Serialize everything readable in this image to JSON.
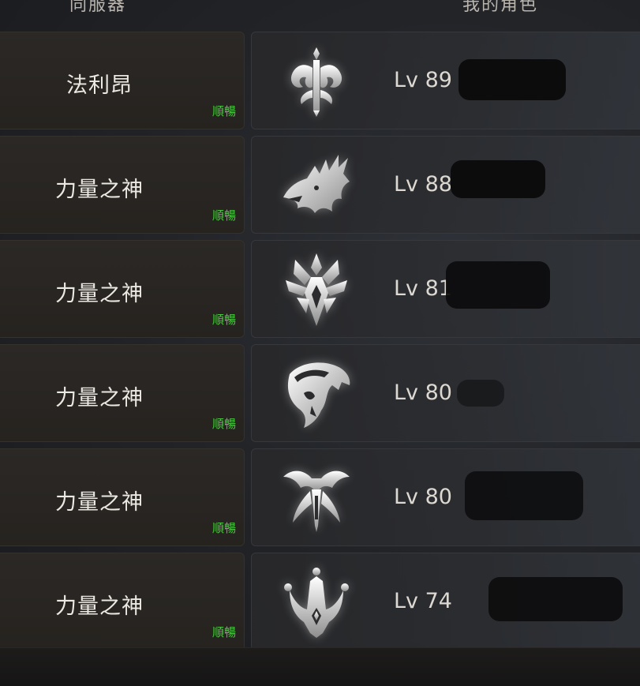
{
  "header": {
    "server_col": "同服器",
    "character_col": "我的角色"
  },
  "rows": [
    {
      "server": "法利昂",
      "status": "順暢",
      "level": "Lv 89",
      "emblem": "sword-wings-emblem-icon"
    },
    {
      "server": "力量之神",
      "status": "順暢",
      "level": "Lv 88",
      "emblem": "dragon-head-emblem-icon"
    },
    {
      "server": "力量之神",
      "status": "順暢",
      "level": "Lv 81",
      "emblem": "thorn-crown-emblem-icon"
    },
    {
      "server": "力量之神",
      "status": "順暢",
      "level": "Lv 80",
      "emblem": "helmet-skull-emblem-icon"
    },
    {
      "server": "力量之神",
      "status": "順暢",
      "level": "Lv 80",
      "emblem": "winged-blade-emblem-icon"
    },
    {
      "server": "力量之神",
      "status": "順暢",
      "level": "Lv 74",
      "emblem": "crown-emblem-icon"
    }
  ],
  "colors": {
    "status": "#4cc641",
    "panel": "#26231f",
    "text": "#ece8e2"
  }
}
